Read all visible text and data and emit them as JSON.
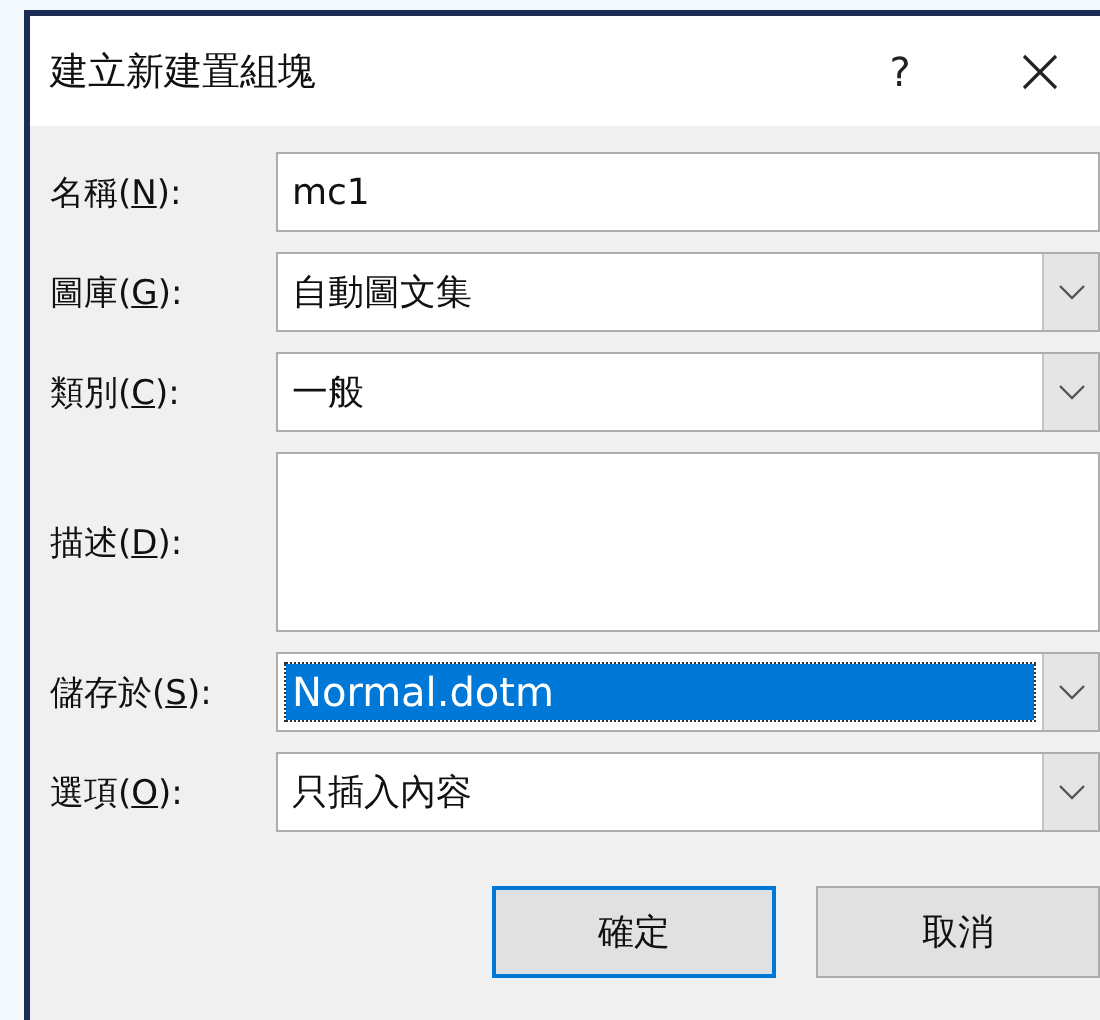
{
  "window": {
    "title": "建立新建置組塊",
    "help": "?"
  },
  "fields": [
    {
      "kind": "text",
      "label": {
        "before": "名稱(",
        "key": "N",
        "after": "):"
      },
      "value": "mc1",
      "selected": false
    },
    {
      "kind": "combo",
      "label": {
        "before": "圖庫(",
        "key": "G",
        "after": "):"
      },
      "value": "自動圖文集",
      "selected": false
    },
    {
      "kind": "combo",
      "label": {
        "before": "類別(",
        "key": "C",
        "after": "):"
      },
      "value": "一般",
      "selected": false
    },
    {
      "kind": "textarea",
      "label": {
        "before": "描述(",
        "key": "D",
        "after": "):"
      },
      "selected": false
    },
    {
      "kind": "combo",
      "label": {
        "before": "儲存於(",
        "key": "S",
        "after": "):"
      },
      "value": "Normal.dotm",
      "selected": true
    },
    {
      "kind": "combo",
      "label": {
        "before": "選項(",
        "key": "O",
        "after": "):"
      },
      "value": "只插入內容",
      "selected": false
    }
  ],
  "buttons": [
    {
      "label": "確定",
      "default": true
    },
    {
      "label": "取消",
      "default": false
    }
  ]
}
